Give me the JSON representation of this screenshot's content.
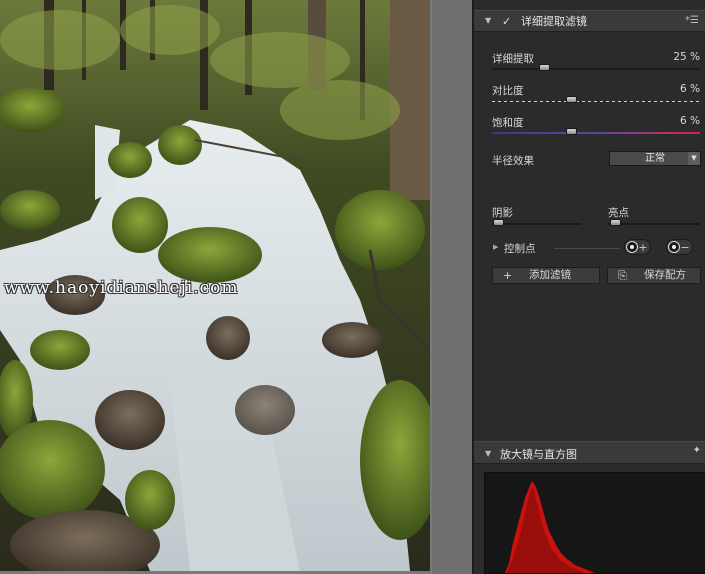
{
  "watermark": "www.haoyidiansheji.com",
  "filter": {
    "title": "详细提取滤镜",
    "sliders": [
      {
        "label": "详细提取",
        "value": "25 %",
        "level": 0.25
      },
      {
        "label": "对比度",
        "value": "6 %",
        "level": 0.38
      },
      {
        "label": "饱和度",
        "value": "6 %",
        "level": 0.38
      }
    ],
    "radius": {
      "label": "半径效果",
      "selected": "正常"
    },
    "shadows_label": "阴影",
    "highlights_label": "亮点",
    "control_points": "控制点",
    "add_filter": "添加滤镜",
    "save_recipe": "保存配方"
  },
  "loupe": {
    "title": "放大镜与直方图"
  },
  "colors": {
    "panel_bg": "#2b2b2b",
    "header_bg": "#3a3a3a",
    "histogram_red": "#c8120f"
  },
  "icons": [
    "collapse-arrow-icon",
    "check-icon",
    "panel-menu-icon",
    "dropdown-caret-icon",
    "expand-arrow-icon",
    "add-point-icon",
    "remove-point-icon",
    "plus-icon",
    "save-recipe-icon",
    "pin-icon"
  ]
}
